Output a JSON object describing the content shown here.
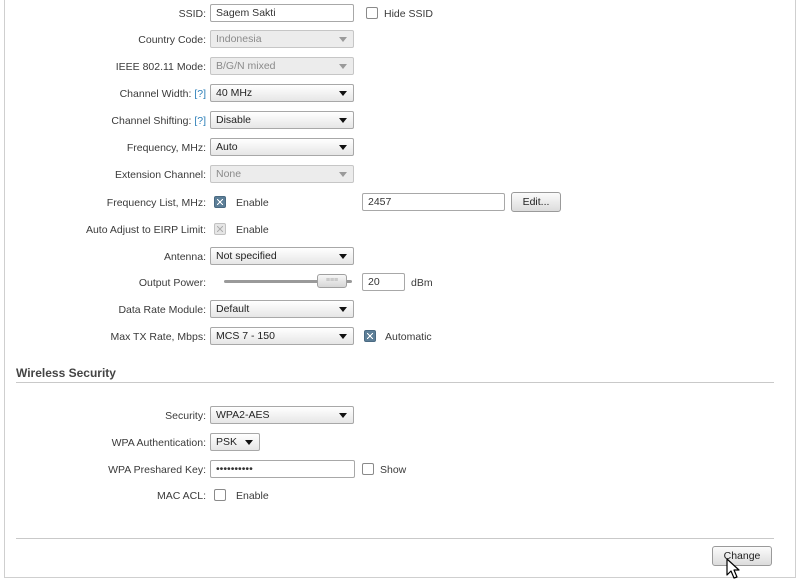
{
  "wireless": {
    "ssid": {
      "label": "SSID:",
      "value": "Sagem Sakti",
      "hide_label": "Hide SSID",
      "hidden": false
    },
    "country": {
      "label": "Country Code:",
      "value": "Indonesia"
    },
    "mode": {
      "label": "IEEE 802.11 Mode:",
      "value": "B/G/N mixed"
    },
    "channel_width": {
      "label": "Channel Width:",
      "help": "[?]",
      "value": "40 MHz"
    },
    "channel_shifting": {
      "label": "Channel Shifting:",
      "help": "[?]",
      "value": "Disable"
    },
    "frequency": {
      "label": "Frequency, MHz:",
      "value": "Auto"
    },
    "extension_channel": {
      "label": "Extension Channel:",
      "value": "None"
    },
    "frequency_list": {
      "label": "Frequency List, MHz:",
      "enable_label": "Enable",
      "enabled": true,
      "value": "2457",
      "edit_label": "Edit..."
    },
    "auto_adjust": {
      "label": "Auto Adjust to EIRP Limit:",
      "enable_label": "Enable",
      "enabled": true,
      "disabled": true
    },
    "antenna": {
      "label": "Antenna:",
      "value": "Not specified"
    },
    "output_power": {
      "label": "Output Power:",
      "value": "20",
      "unit": "dBm",
      "slider_fraction": 0.95
    },
    "data_rate_module": {
      "label": "Data Rate Module:",
      "value": "Default"
    },
    "max_tx_rate": {
      "label": "Max TX Rate, Mbps:",
      "value": "MCS 7 - 150",
      "auto_label": "Automatic",
      "auto": true
    }
  },
  "security": {
    "section_title": "Wireless Security",
    "security": {
      "label": "Security:",
      "value": "WPA2-AES"
    },
    "wpa_auth": {
      "label": "WPA Authentication:",
      "value": "PSK"
    },
    "psk": {
      "label": "WPA Preshared Key:",
      "value": "••••••••••",
      "show_label": "Show",
      "shown": false
    },
    "mac_acl": {
      "label": "MAC ACL:",
      "enable_label": "Enable",
      "enabled": false
    }
  },
  "footer": {
    "change_label": "Change"
  },
  "colors": {
    "checkbox_checked": "#5d7f98",
    "help_link": "#2d7fb8"
  }
}
